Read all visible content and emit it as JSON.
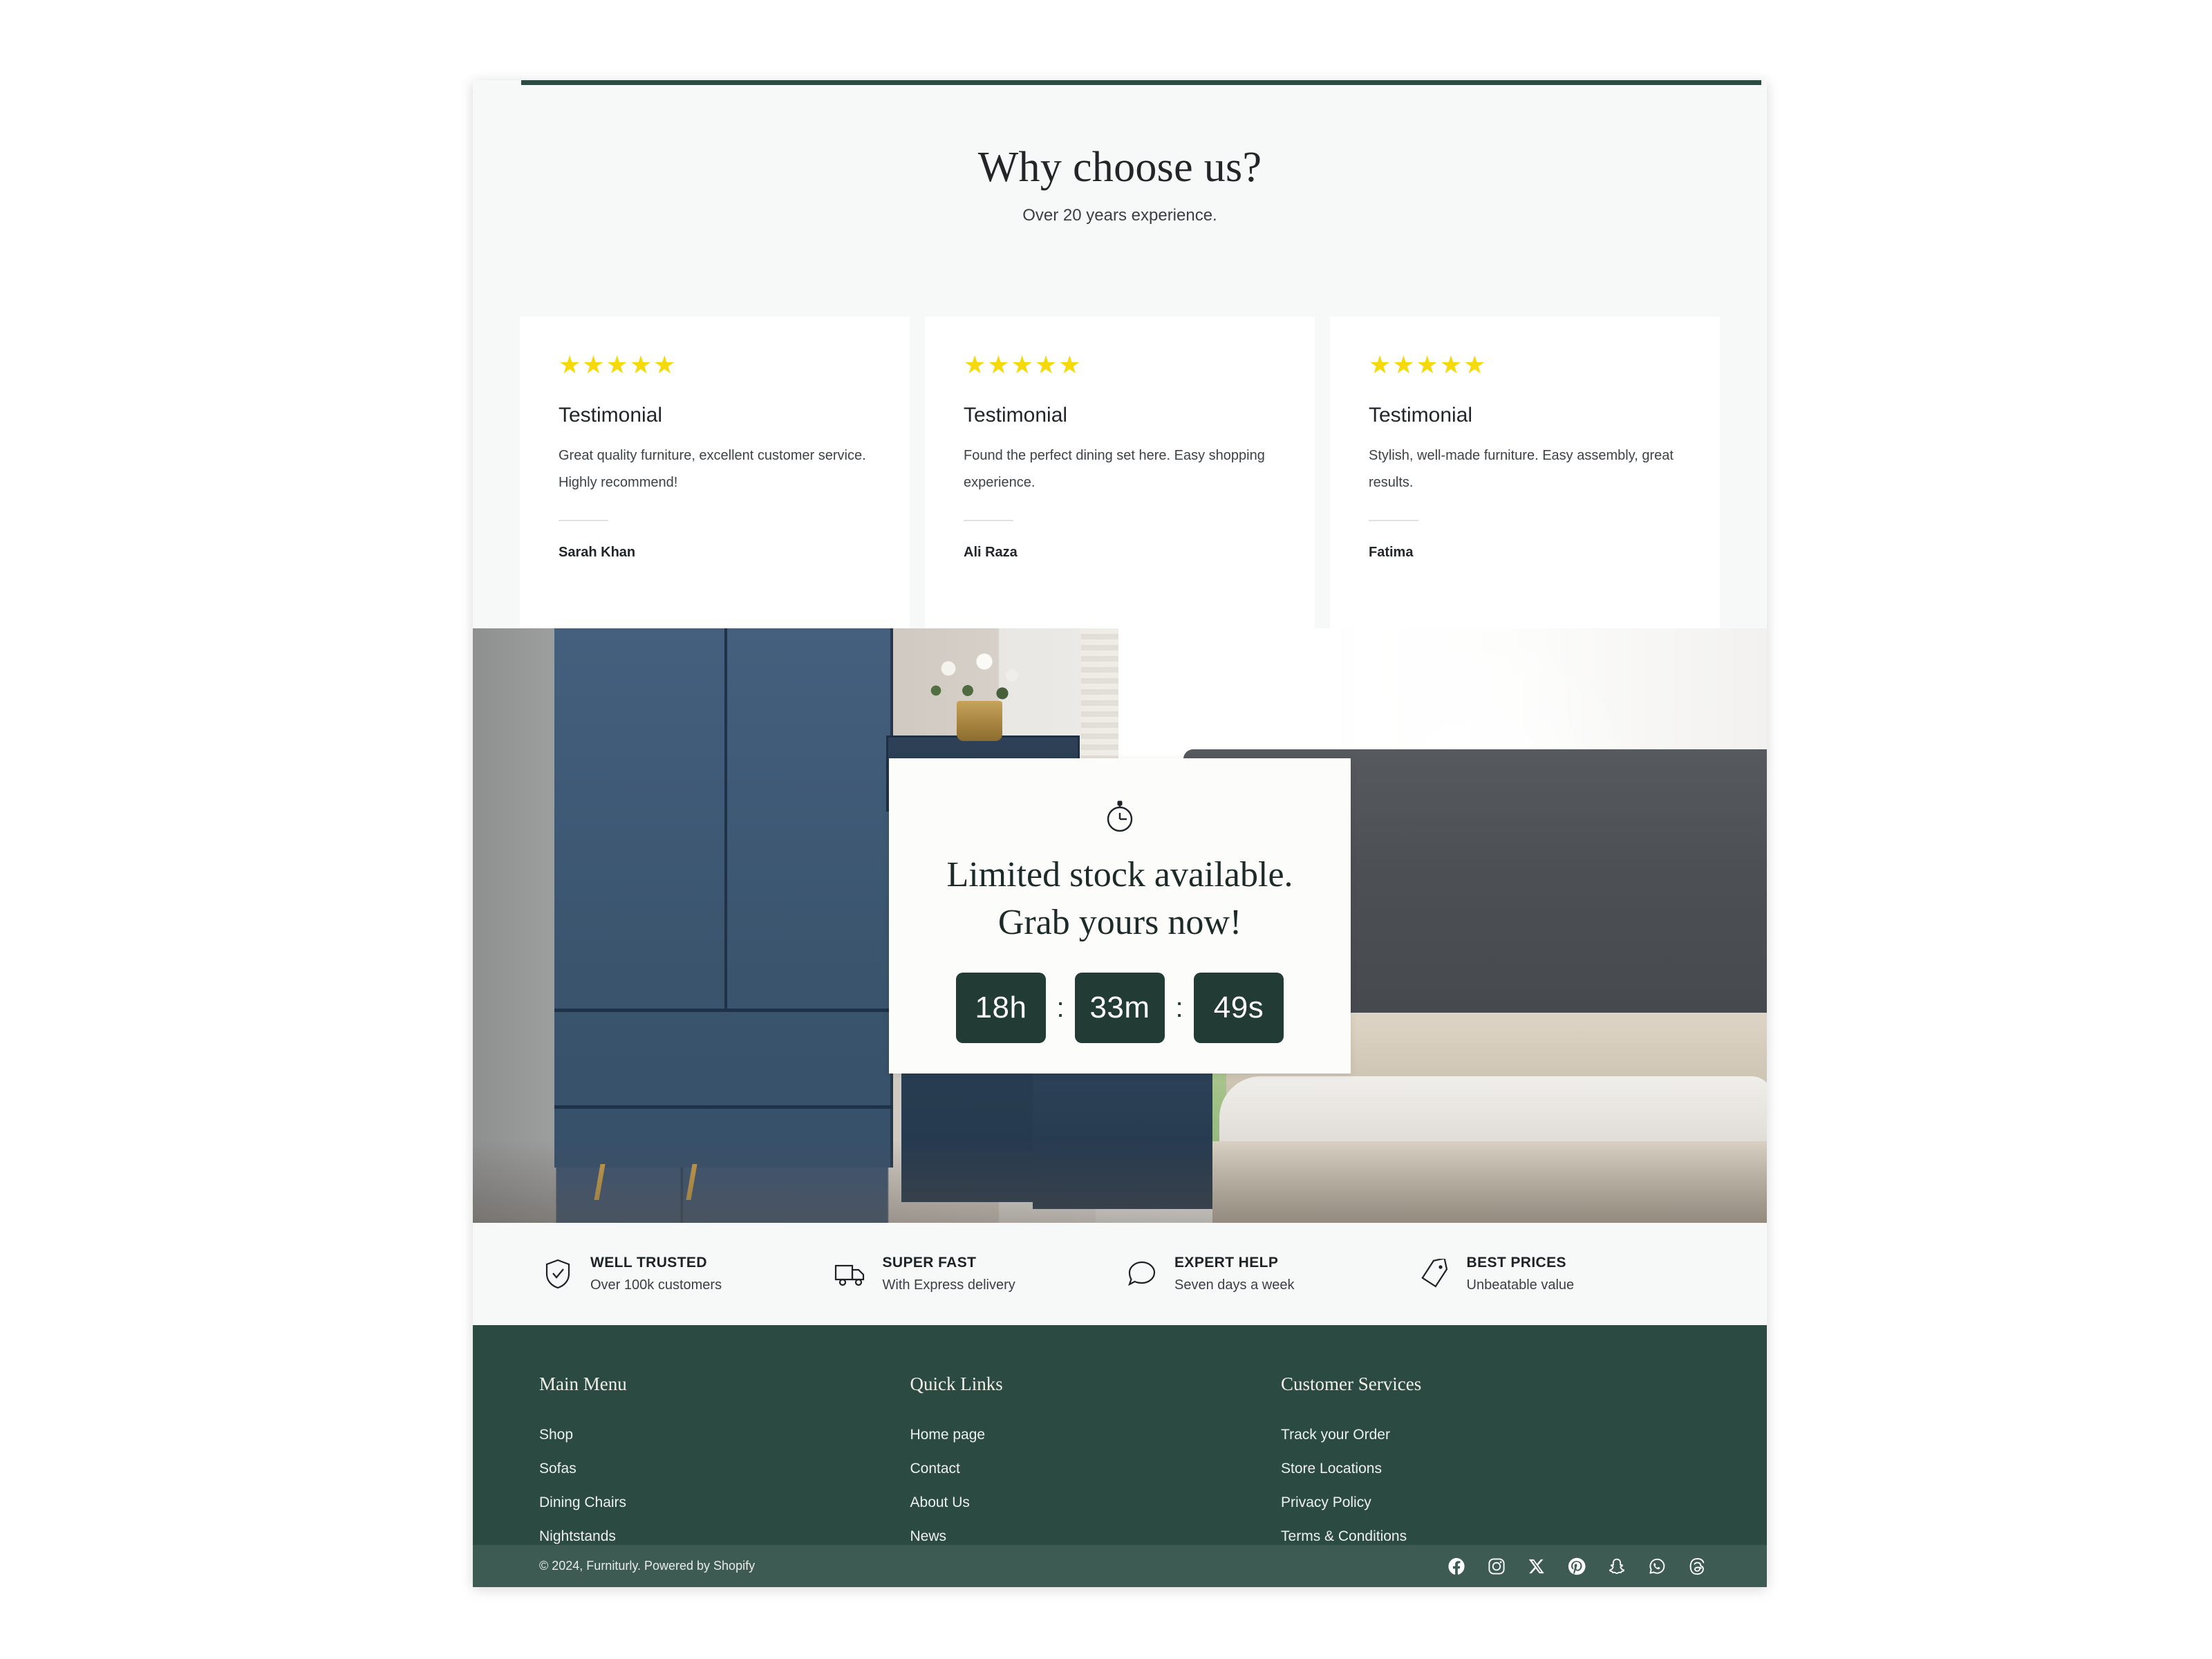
{
  "why_choose_us": {
    "title": "Why choose us?",
    "subtitle": "Over 20 years experience."
  },
  "testimonials": [
    {
      "stars": "★★★★★",
      "heading": "Testimonial",
      "body": "Great quality furniture, excellent customer service. Highly recommend!",
      "author": "Sarah Khan"
    },
    {
      "stars": "★★★★★",
      "heading": "Testimonial",
      "body": "Found the perfect dining set here. Easy shopping experience.",
      "author": "Ali Raza"
    },
    {
      "stars": "★★★★★",
      "heading": "Testimonial",
      "body": "Stylish, well-made furniture. Easy assembly, great results.",
      "author": "Fatima"
    }
  ],
  "countdown": {
    "icon": "stopwatch-icon",
    "headline_line1": "Limited stock available.",
    "headline_line2": "Grab yours now!",
    "hours": "18h",
    "minutes": "33m",
    "seconds": "49s",
    "separator": ":",
    "box_color": "#223c35"
  },
  "badges": [
    {
      "icon": "shield-check-icon",
      "title": "WELL TRUSTED",
      "subtitle": "Over 100k customers"
    },
    {
      "icon": "truck-icon",
      "title": "SUPER FAST",
      "subtitle": "With Express delivery"
    },
    {
      "icon": "chat-bubble-icon",
      "title": "EXPERT HELP",
      "subtitle": "Seven days a week"
    },
    {
      "icon": "price-tag-icon",
      "title": "BEST PRICES",
      "subtitle": "Unbeatable value"
    }
  ],
  "footer": {
    "background_color": "#2b4a42",
    "bottom_bar_color": "#3e5b53",
    "columns": [
      {
        "title": "Main Menu",
        "links": [
          "Shop",
          "Sofas",
          "Dining Chairs",
          "Nightstands"
        ]
      },
      {
        "title": "Quick Links",
        "links": [
          "Home page",
          "Contact",
          "About Us",
          "News"
        ]
      },
      {
        "title": "Customer Services",
        "links": [
          "Track your Order",
          "Store Locations",
          "Privacy Policy",
          "Terms & Conditions"
        ]
      }
    ],
    "copyright": "© 2024, Furniturly.  Powered by Shopify",
    "socials": [
      "facebook-icon",
      "instagram-icon",
      "x-twitter-icon",
      "pinterest-icon",
      "snapchat-icon",
      "whatsapp-icon",
      "threads-icon"
    ]
  }
}
